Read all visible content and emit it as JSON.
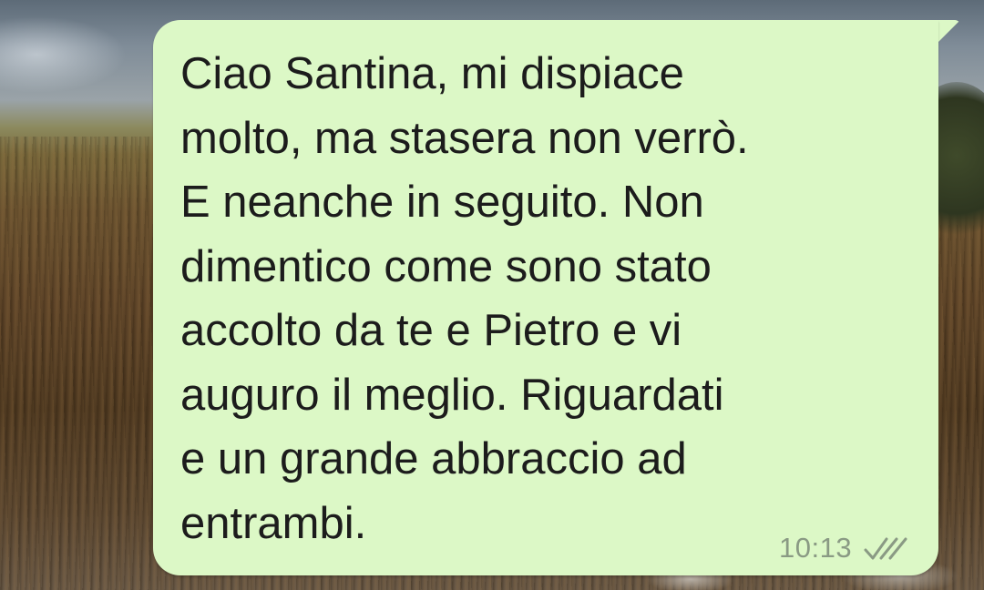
{
  "chat": {
    "message": {
      "text": "Ciao Santina, mi dispiace\nmolto, ma stasera non verrò.\nE neanche in seguito. Non\ndimentico come sono stato\naccolto da te e Pietro e vi\nauguro il meglio. Riguardati\ne un grande abbraccio ad\nentrambi.",
      "time": "10:13",
      "status_icon": "double-check-icon",
      "direction": "outgoing"
    }
  },
  "colors": {
    "bubble": "#dcf8c6",
    "text": "#1c1c1c",
    "meta": "#8a9a84"
  }
}
